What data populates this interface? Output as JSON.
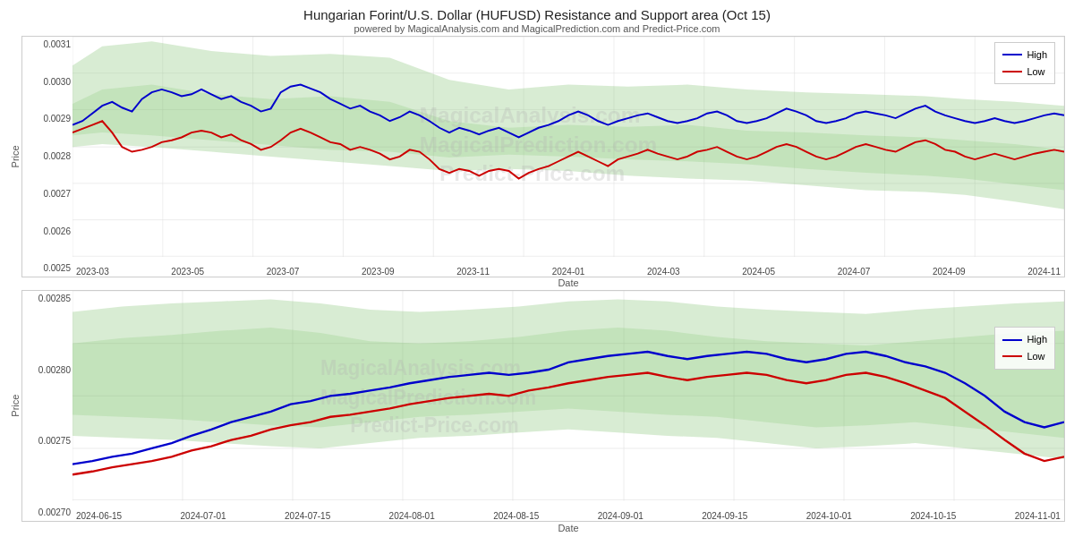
{
  "header": {
    "main_title": "Hungarian Forint/U.S. Dollar (HUFUSD) Resistance and Support area (Oct 15)",
    "subtitle": "powered by MagicalAnalysis.com and MagicalPrediction.com and Predict-Price.com"
  },
  "y_axis_label": "Price",
  "x_axis_label": "Date",
  "chart_top": {
    "y_ticks": [
      "0.0031",
      "0.0030",
      "0.0029",
      "0.0028",
      "0.0027",
      "0.0026",
      "0.0025"
    ],
    "x_ticks": [
      "2023-03",
      "2023-05",
      "2023-07",
      "2023-09",
      "2023-11",
      "2024-01",
      "2024-03",
      "2024-05",
      "2024-07",
      "2024-09",
      "2024-11"
    ],
    "legend": {
      "high_label": "High",
      "low_label": "Low",
      "high_color": "#0000cc",
      "low_color": "#cc0000"
    }
  },
  "chart_bottom": {
    "y_ticks": [
      "0.00285",
      "0.00280",
      "0.00275",
      "0.00270"
    ],
    "x_ticks": [
      "2024-06-15",
      "2024-07-01",
      "2024-07-15",
      "2024-08-01",
      "2024-08-15",
      "2024-09-01",
      "2024-09-15",
      "2024-10-01",
      "2024-10-15",
      "2024-11-01"
    ],
    "legend": {
      "high_label": "High",
      "low_label": "Low",
      "high_color": "#0000cc",
      "low_color": "#cc0000"
    }
  },
  "watermark_text": "MagicalAnalysis.com\nMagicalPrediction.com\nPredict-Price.com"
}
